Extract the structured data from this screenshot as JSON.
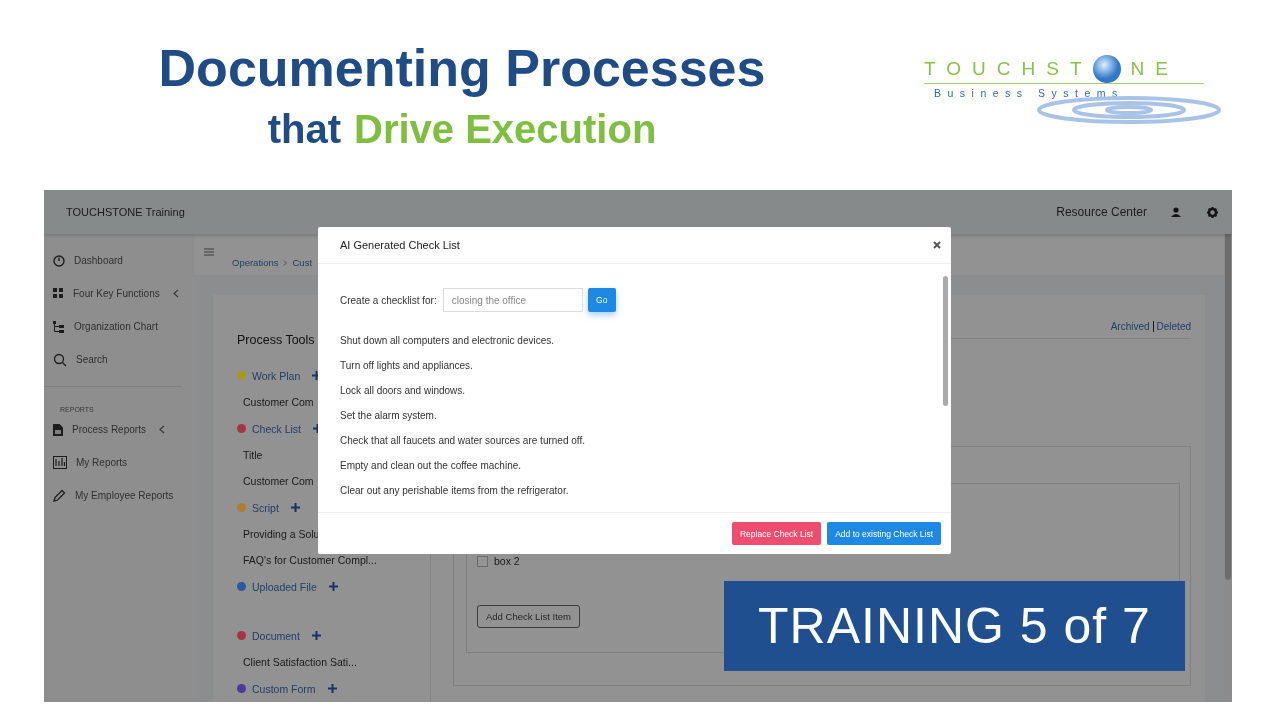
{
  "headline": {
    "line1": "Documenting Processes",
    "line2_lead": "that",
    "line2_highlight": "Drive Execution"
  },
  "logo": {
    "wordmark_start": "TOUCHST",
    "wordmark_end": "NE",
    "tagline": "Business Systems"
  },
  "app": {
    "topbar": {
      "title": "TOUCHSTONE Training",
      "link": "Resource Center"
    },
    "sidebar": {
      "items": [
        {
          "kind": "item",
          "label": "Dashboard",
          "expandable": false
        },
        {
          "kind": "item",
          "label": "Four Key Functions",
          "expandable": true
        },
        {
          "kind": "item",
          "label": "Organization Chart",
          "expandable": false
        },
        {
          "kind": "item",
          "label": "Search",
          "expandable": false
        },
        {
          "kind": "section",
          "label": "REPORTS"
        },
        {
          "kind": "item",
          "label": "Process Reports",
          "expandable": true
        },
        {
          "kind": "item",
          "label": "My Reports",
          "expandable": false
        },
        {
          "kind": "item",
          "label": "My Employee Reports",
          "expandable": false
        }
      ]
    },
    "breadcrumb": [
      "Operations",
      "Cust"
    ],
    "process_tools": {
      "title": "Process Tools",
      "groups": [
        {
          "label": "Work Plan",
          "color": "#a59a1c",
          "items": [
            "Customer Com"
          ]
        },
        {
          "label": "Check List",
          "color": "#a83349",
          "items": [
            "Title",
            "Customer Com"
          ]
        },
        {
          "label": "Script",
          "color": "#b07c34",
          "items": [
            "Providing a Solu",
            "FAQ's for Customer Compl..."
          ]
        },
        {
          "label": "Uploaded File",
          "color": "#2a5c9c"
        },
        {
          "label": "Document",
          "color": "#a83349",
          "items": [
            "Client Satisfaction Sati..."
          ]
        },
        {
          "label": "Custom Form",
          "color": "#4a3a9c"
        }
      ]
    },
    "links": [
      "Archived",
      "Deleted"
    ],
    "checklist": {
      "items": [
        {
          "label": "box 2",
          "checked": false
        }
      ],
      "add_button": "Add Check List Item"
    }
  },
  "modal": {
    "title": "AI Generated Check List",
    "prompt_label": "Create a checklist for:",
    "prompt_value": "closing the office",
    "go_button": "Go",
    "items": [
      "Shut down all computers and electronic devices.",
      "Turn off lights and appliances.",
      "Lock all doors and windows.",
      "Set the alarm system.",
      "Check that all faucets and water sources are turned off.",
      "Empty and clean out the coffee machine.",
      "Clear out any perishable items from the refrigerator."
    ],
    "buttons": [
      {
        "kind": "danger",
        "label": "Replace Check List"
      },
      {
        "kind": "primary",
        "label": "Add to existing Check List"
      }
    ]
  },
  "banner": "TRAINING 5 of 7"
}
